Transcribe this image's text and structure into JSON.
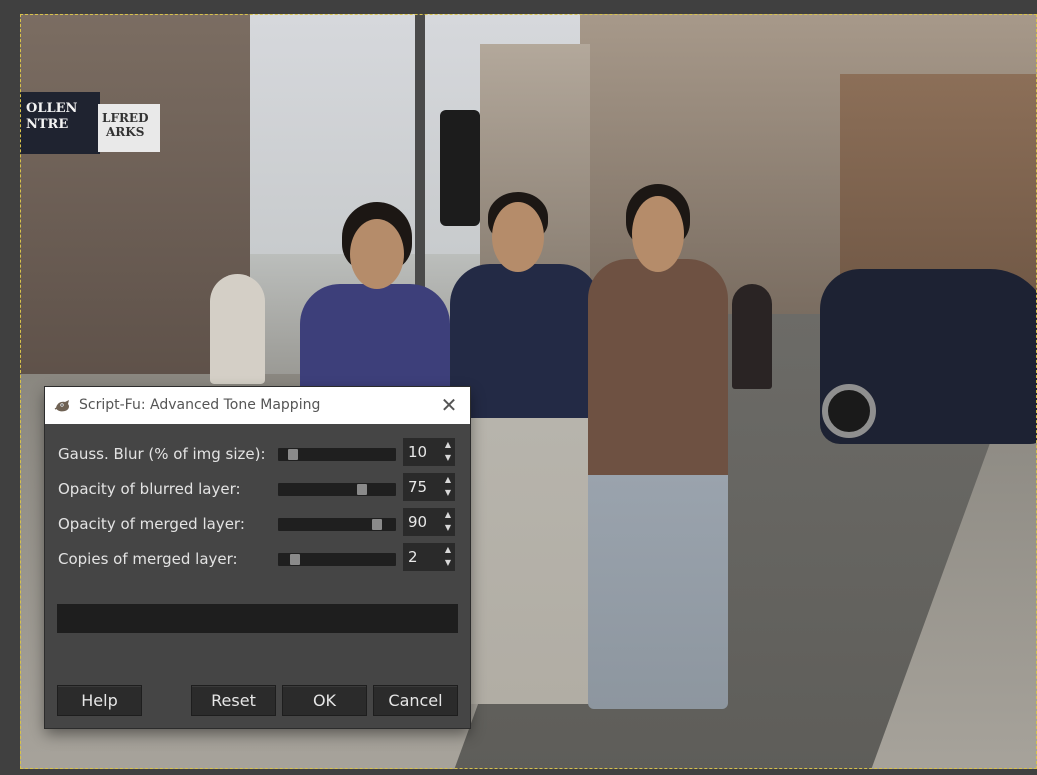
{
  "dialog": {
    "title": "Script-Fu: Advanced Tone Mapping",
    "icon": "gimp-wilber-icon",
    "close_icon": "close-icon",
    "fields": [
      {
        "label": "Gauss. Blur (% of img size):",
        "value": "10",
        "slider_fraction": 0.1
      },
      {
        "label": "Opacity of blurred layer:",
        "value": "75",
        "slider_fraction": 0.75
      },
      {
        "label": "Opacity of merged layer:",
        "value": "90",
        "slider_fraction": 0.9
      },
      {
        "label": "Copies of merged layer:",
        "value": "2",
        "slider_fraction": 0.12
      }
    ],
    "progress_text": "",
    "buttons": {
      "help": "Help",
      "reset": "Reset",
      "ok": "OK",
      "cancel": "Cancel"
    }
  },
  "photo": {
    "signs": [
      "OLLEN",
      "NTRE",
      "LFRED",
      "ARKS"
    ]
  },
  "colors": {
    "dialog_bg": "#454545",
    "titlebar_bg": "#ffffff",
    "button_bg": "#2b2b2b",
    "selection_border": "#d8c24a"
  }
}
